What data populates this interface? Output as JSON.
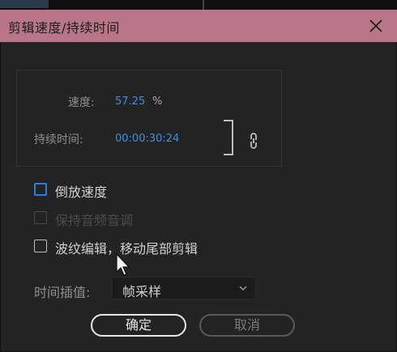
{
  "dialog": {
    "title": "剪辑速度/持续时间",
    "close_icon": "close-icon"
  },
  "speed": {
    "label": "速度:",
    "value": "57.25",
    "unit": "%"
  },
  "duration": {
    "label": "持续时间:",
    "value": "00:00:30:24"
  },
  "link_icon": "chain-link-icon",
  "options": {
    "reverse_speed": {
      "label": "倒放速度",
      "checked": false,
      "enabled": true
    },
    "maintain_pitch": {
      "label": "保持音频音调",
      "checked": false,
      "enabled": false
    },
    "ripple_edit": {
      "label": "波纹编辑，移动尾部剪辑",
      "checked": false,
      "enabled": true
    }
  },
  "interpolation": {
    "label": "时间插值:",
    "selected": "帧采样"
  },
  "buttons": {
    "ok_label": "确定",
    "cancel_label": "取消"
  },
  "colors": {
    "titlebar": "#b9768a",
    "value_blue": "#3d8ee0",
    "focus_blue": "#2f7fd8"
  }
}
